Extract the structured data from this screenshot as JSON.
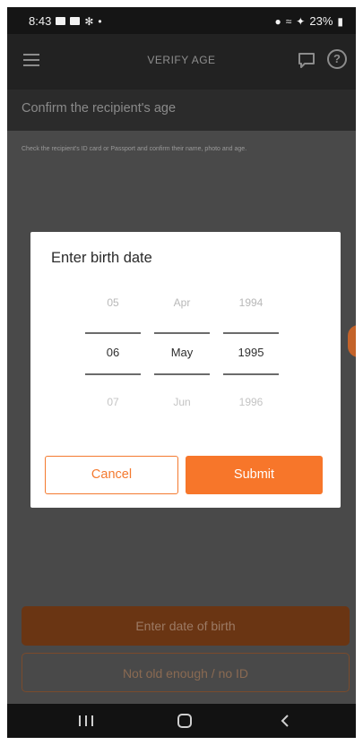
{
  "status_bar": {
    "time": "8:43",
    "battery": "23%"
  },
  "app_bar": {
    "title": "VERIFY AGE"
  },
  "subheader": {
    "title": "Confirm the recipient's age"
  },
  "instructions": "Check the recipient's ID card or Passport and confirm their name, photo and age.",
  "dialog": {
    "title": "Enter birth date",
    "day": {
      "prev": "05",
      "selected": "06",
      "next": "07"
    },
    "month": {
      "prev": "Apr",
      "selected": "May",
      "next": "Jun"
    },
    "year": {
      "prev": "1994",
      "selected": "1995",
      "next": "1996"
    },
    "cancel_label": "Cancel",
    "submit_label": "Submit"
  },
  "actions": {
    "enter_dob_label": "Enter date of birth",
    "no_id_label": "Not old enough / no ID"
  },
  "colors": {
    "accent": "#f7762a",
    "app_bar": "#222222",
    "dim_overlay": "#494949"
  }
}
